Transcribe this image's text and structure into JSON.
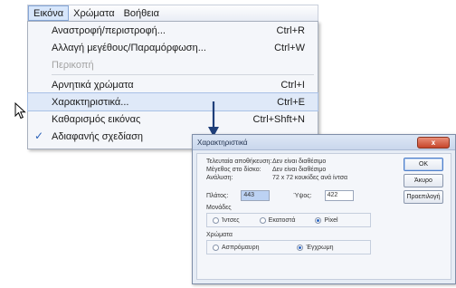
{
  "menubar": {
    "items": [
      "Εικόνα",
      "Χρώματα",
      "Βοήθεια"
    ]
  },
  "menu": {
    "items": [
      {
        "label": "Αναστροφή/περιστροφή...",
        "shortcut": "Ctrl+R"
      },
      {
        "label": "Αλλαγή μεγέθους/Παραμόρφωση...",
        "shortcut": "Ctrl+W"
      },
      {
        "label": "Περικοπή",
        "shortcut": ""
      },
      {
        "label": "Αρνητικά χρώματα",
        "shortcut": "Ctrl+I"
      },
      {
        "label": "Χαρακτηριστικά...",
        "shortcut": "Ctrl+E"
      },
      {
        "label": "Καθαρισμός εικόνας",
        "shortcut": "Ctrl+Shft+N"
      },
      {
        "label": "Αδιαφανής σχεδίαση",
        "shortcut": ""
      }
    ],
    "check_mark": "✓"
  },
  "dialog": {
    "title": "Χαρακτηριστικά",
    "close_label": "x",
    "info": [
      {
        "key": "Τελευταία αποθήκευση:",
        "value": "Δεν είναι διαθέσιμο"
      },
      {
        "key": "Μέγεθος στο δίσκο:",
        "value": "Δεν είναι διαθέσιμο"
      },
      {
        "key": "Ανάλυση:",
        "value": "72 x 72 κουκίδες ανά ίντσα"
      }
    ],
    "width_label": "Πλάτος:",
    "width_value": "443",
    "height_label": "Ύψος:",
    "height_value": "422",
    "units_label": "Μονάδες",
    "units": [
      "Ίντσες",
      "Εκατοστά",
      "Pixel"
    ],
    "units_selected": 2,
    "colors_label": "Χρώματα",
    "colors": [
      "Ασπρόμαυρη",
      "Έγχρωμη"
    ],
    "colors_selected": 1,
    "buttons": {
      "ok": "OK",
      "cancel": "Άκυρο",
      "default": "Προεπιλογή"
    }
  },
  "colors": {
    "highlight": "#dfe9f8",
    "accent": "#2b66c4",
    "close_button": "#c6452a"
  }
}
